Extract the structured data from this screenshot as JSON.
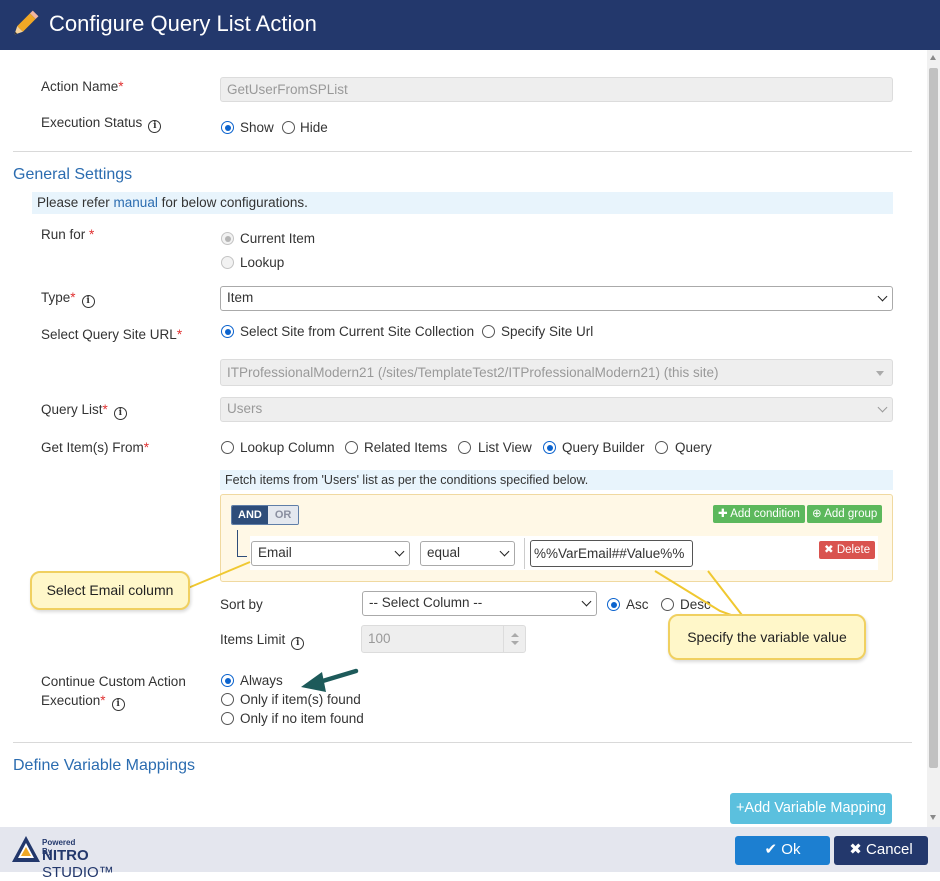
{
  "dialog": {
    "title": "Configure Query List Action"
  },
  "action_name": {
    "label": "Action Name",
    "required_mark": "*",
    "value": "GetUserFromSPList"
  },
  "execution_status": {
    "label": "Execution Status",
    "options": [
      "Show",
      "Hide"
    ],
    "selected": "Show"
  },
  "general_settings": {
    "heading": "General Settings",
    "notice_prefix": "Please refer ",
    "notice_link": "manual",
    "notice_suffix": " for below configurations."
  },
  "run_for": {
    "label": "Run for ",
    "required_mark": "*",
    "options": [
      "Current Item",
      "Lookup"
    ],
    "selected": "Current Item"
  },
  "type": {
    "label": "Type",
    "required_mark": "*",
    "value": "Item"
  },
  "query_site": {
    "label": "Select Query Site URL",
    "required_mark": "*",
    "options": [
      "Select Site from Current Site Collection",
      "Specify Site Url"
    ],
    "selected": "Select Site from Current Site Collection",
    "site_value": "ITProfessionalModern21 (/sites/TemplateTest2/ITProfessionalModern21) (this site)"
  },
  "query_list": {
    "label": "Query List",
    "required_mark": "*",
    "value": "Users"
  },
  "get_items_from": {
    "label": "Get Item(s) From",
    "required_mark": "*",
    "options": [
      "Lookup Column",
      "Related Items",
      "List View",
      "Query Builder",
      "Query"
    ],
    "selected": "Query Builder"
  },
  "query_builder": {
    "hint": "Fetch items from 'Users' list as per the conditions specified below.",
    "and_label": "AND",
    "or_label": "OR",
    "add_condition": "Add condition",
    "add_group": "Add group",
    "rule": {
      "field": "Email",
      "operator": "equal",
      "value": "%%VarEmail##Value%%"
    },
    "delete": "Delete"
  },
  "sort_by": {
    "label": "Sort by",
    "value": "-- Select Column --",
    "options": [
      "Asc",
      "Desc"
    ],
    "selected": "Asc",
    "desc_visible": "Desc"
  },
  "items_limit": {
    "label": "Items Limit",
    "value": "100"
  },
  "continue_execution": {
    "label_line1": "Continue Custom Action",
    "label_line2": "Execution",
    "required_mark": "*",
    "options": [
      "Always",
      "Only if item(s) found",
      "Only if no item found"
    ],
    "selected": "Always"
  },
  "variable_mappings": {
    "heading": "Define Variable Mappings",
    "add_button": "Add Variable Mapping"
  },
  "callouts": {
    "email_column": "Select Email column",
    "variable_value": "Specify the variable value"
  },
  "footer": {
    "powered_by": "Powered By",
    "brand_main": "NITRO",
    "brand_sub": " STUDIO™",
    "ok_button": "Ok",
    "cancel_button": "Cancel"
  },
  "colors": {
    "header": "#23386c",
    "primary": "#1c7fd1",
    "link": "#2b6cb0",
    "success": "#5cb85c",
    "danger": "#d9534f",
    "callout": "#fff7c9"
  }
}
